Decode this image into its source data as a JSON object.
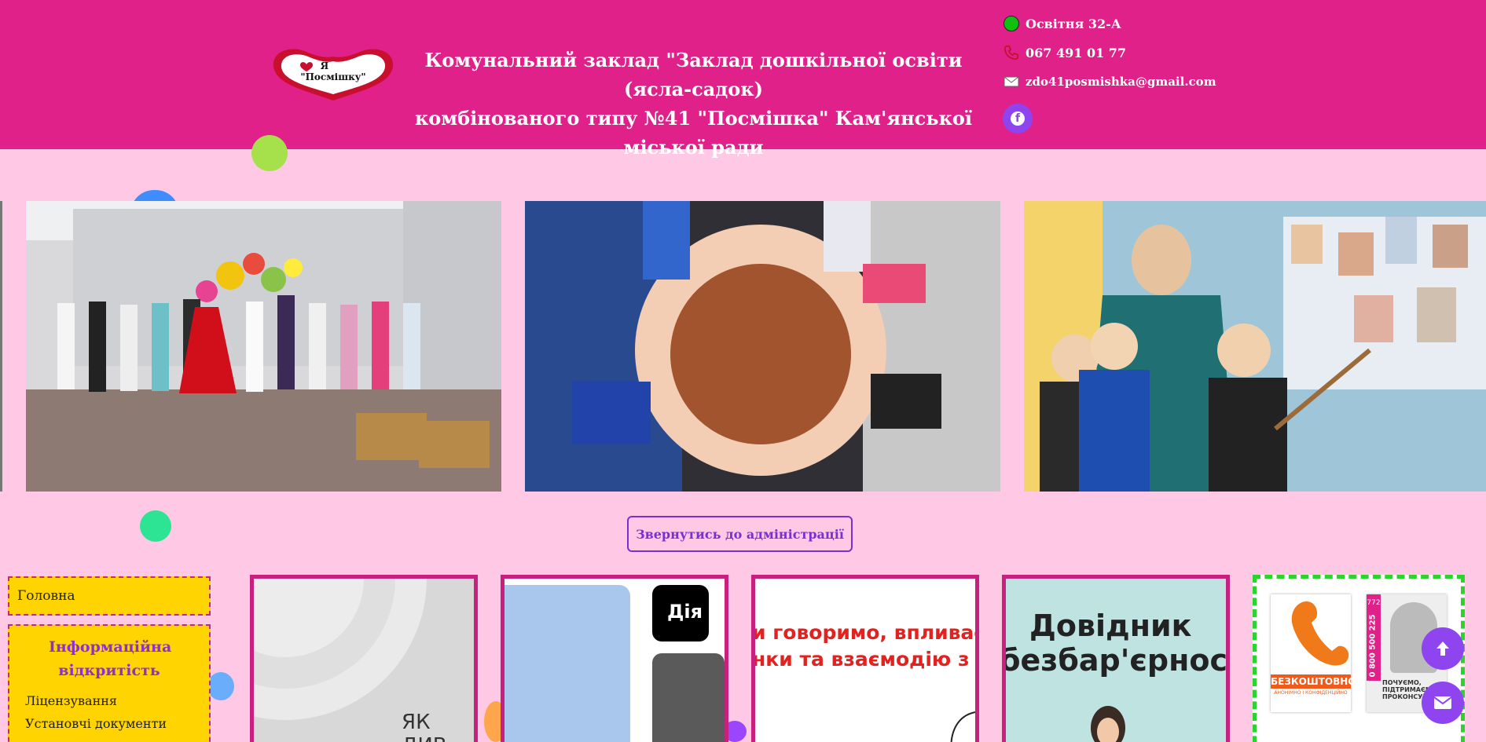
{
  "header": {
    "logo_text_line1": "Я",
    "logo_text_line2": "\"Посмішку\"",
    "title_line1": "Комунальний заклад \"Заклад дошкільної освіти (ясла-садок)",
    "title_line2": "комбінованого типу №41 \"Посмішка\" Кам'янської міської ради",
    "address": "Освітня 32-А",
    "phone": "067 491 01 77",
    "email": "zdo41posmishka@gmail.com",
    "icons": {
      "address": "green-dot-icon",
      "phone": "phone-icon",
      "email": "envelope-icon",
      "social": "facebook-icon"
    },
    "facebook_glyph": "f"
  },
  "admin_button": {
    "label": "Звернутись до адміністрації"
  },
  "sidebar": {
    "home": "Головна",
    "section_title": "Інформаційна відкритість",
    "items": [
      "Ліцензування",
      "Установчі документи"
    ]
  },
  "cards": [
    {
      "caption": "ЯК ДИВ"
    },
    {
      "caption": "Дія"
    },
    {
      "caption_line1": "и говоримо, впливає",
      "caption_line2": "нки та взаємодію з ін"
    },
    {
      "caption_line1": "Довідник",
      "caption_line2": "безбар'єрності"
    },
    {
      "caption_left": "БЕЗКОШТОВНО",
      "caption_left_small": "АНОНІМНО І КОНФІДЕНЦІЙНО",
      "phone_vertical": "0 800 500 225",
      "short": "772",
      "caption_right": "ПОЧУЄМО, ПІДТРИМАЄМО, ПРОКОНСУЛЬ"
    }
  ],
  "fabs": {
    "top": "arrow-up-icon",
    "mail": "envelope-icon"
  },
  "colors": {
    "header": "#e0218a",
    "background": "#ffc9e6",
    "accent": "#8e44ef",
    "sidebar": "#ffd400",
    "card_border": "#c8207f"
  }
}
